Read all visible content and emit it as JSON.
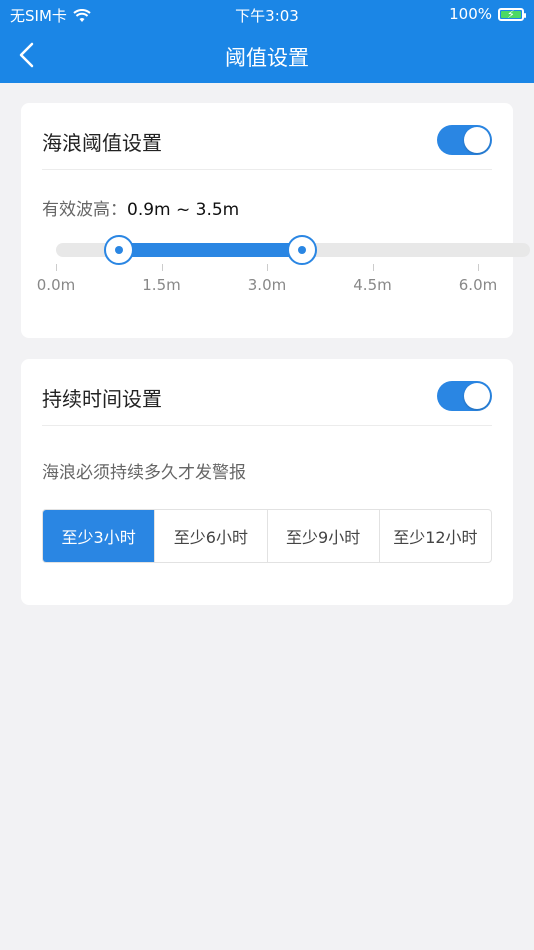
{
  "status": {
    "carrier": "无SIM卡",
    "time": "下午3:03",
    "battery": "100%"
  },
  "nav": {
    "title": "阈值设置"
  },
  "wave": {
    "title": "海浪阈值设置",
    "enabled": true,
    "label": "有效波高：",
    "value_text": "0.9m ~ 3.5m",
    "min": 0.0,
    "max": 6.0,
    "low": 0.9,
    "high": 3.5,
    "ticks": [
      "0.0m",
      "1.5m",
      "3.0m",
      "4.5m",
      "6.0m"
    ],
    "tick_values": [
      0.0,
      1.5,
      3.0,
      4.5,
      6.0
    ]
  },
  "duration": {
    "title": "持续时间设置",
    "enabled": true,
    "description": "海浪必须持续多久才发警报",
    "options": [
      "至少3小时",
      "至少6小时",
      "至少9小时",
      "至少12小时"
    ],
    "selected_index": 0
  },
  "colors": {
    "accent": "#2a86e3",
    "navbar": "#1b86e6"
  }
}
